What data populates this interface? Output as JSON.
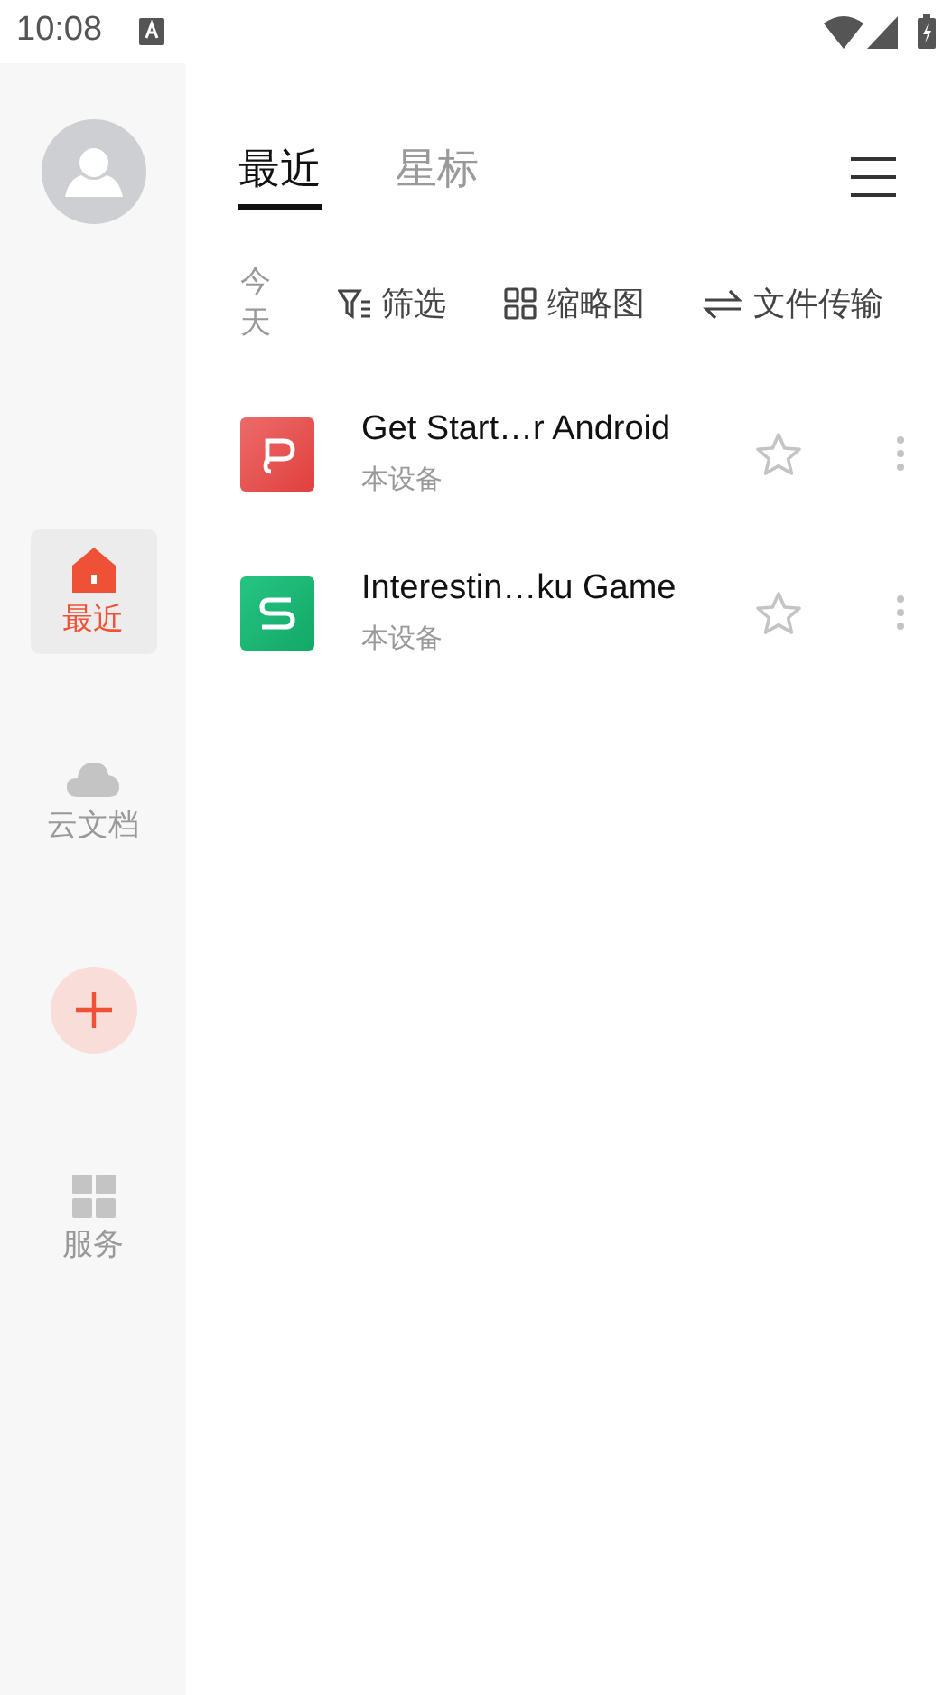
{
  "status_bar": {
    "time": "10:08"
  },
  "sidebar": {
    "items": [
      {
        "kind": "home",
        "label": "最近",
        "selected": true
      },
      {
        "kind": "cloud",
        "label": "云文档",
        "selected": false
      },
      {
        "kind": "add"
      },
      {
        "kind": "services",
        "label": "服务",
        "selected": false
      }
    ]
  },
  "tabs": [
    {
      "label": "最近",
      "selected": true
    },
    {
      "label": "星标",
      "selected": false
    }
  ],
  "toolbar": {
    "group_label": "今天",
    "actions": [
      {
        "kind": "filter",
        "label": "筛选"
      },
      {
        "kind": "thumbnails",
        "label": "缩略图"
      },
      {
        "kind": "transfer",
        "label": "文件传输"
      }
    ]
  },
  "files": [
    {
      "kind": "presentation",
      "name": "Get Start…r Android",
      "location": "本设备",
      "starred": false
    },
    {
      "kind": "spreadsheet",
      "name": "Interestin…ku Game",
      "location": "本设备",
      "starred": false
    }
  ]
}
